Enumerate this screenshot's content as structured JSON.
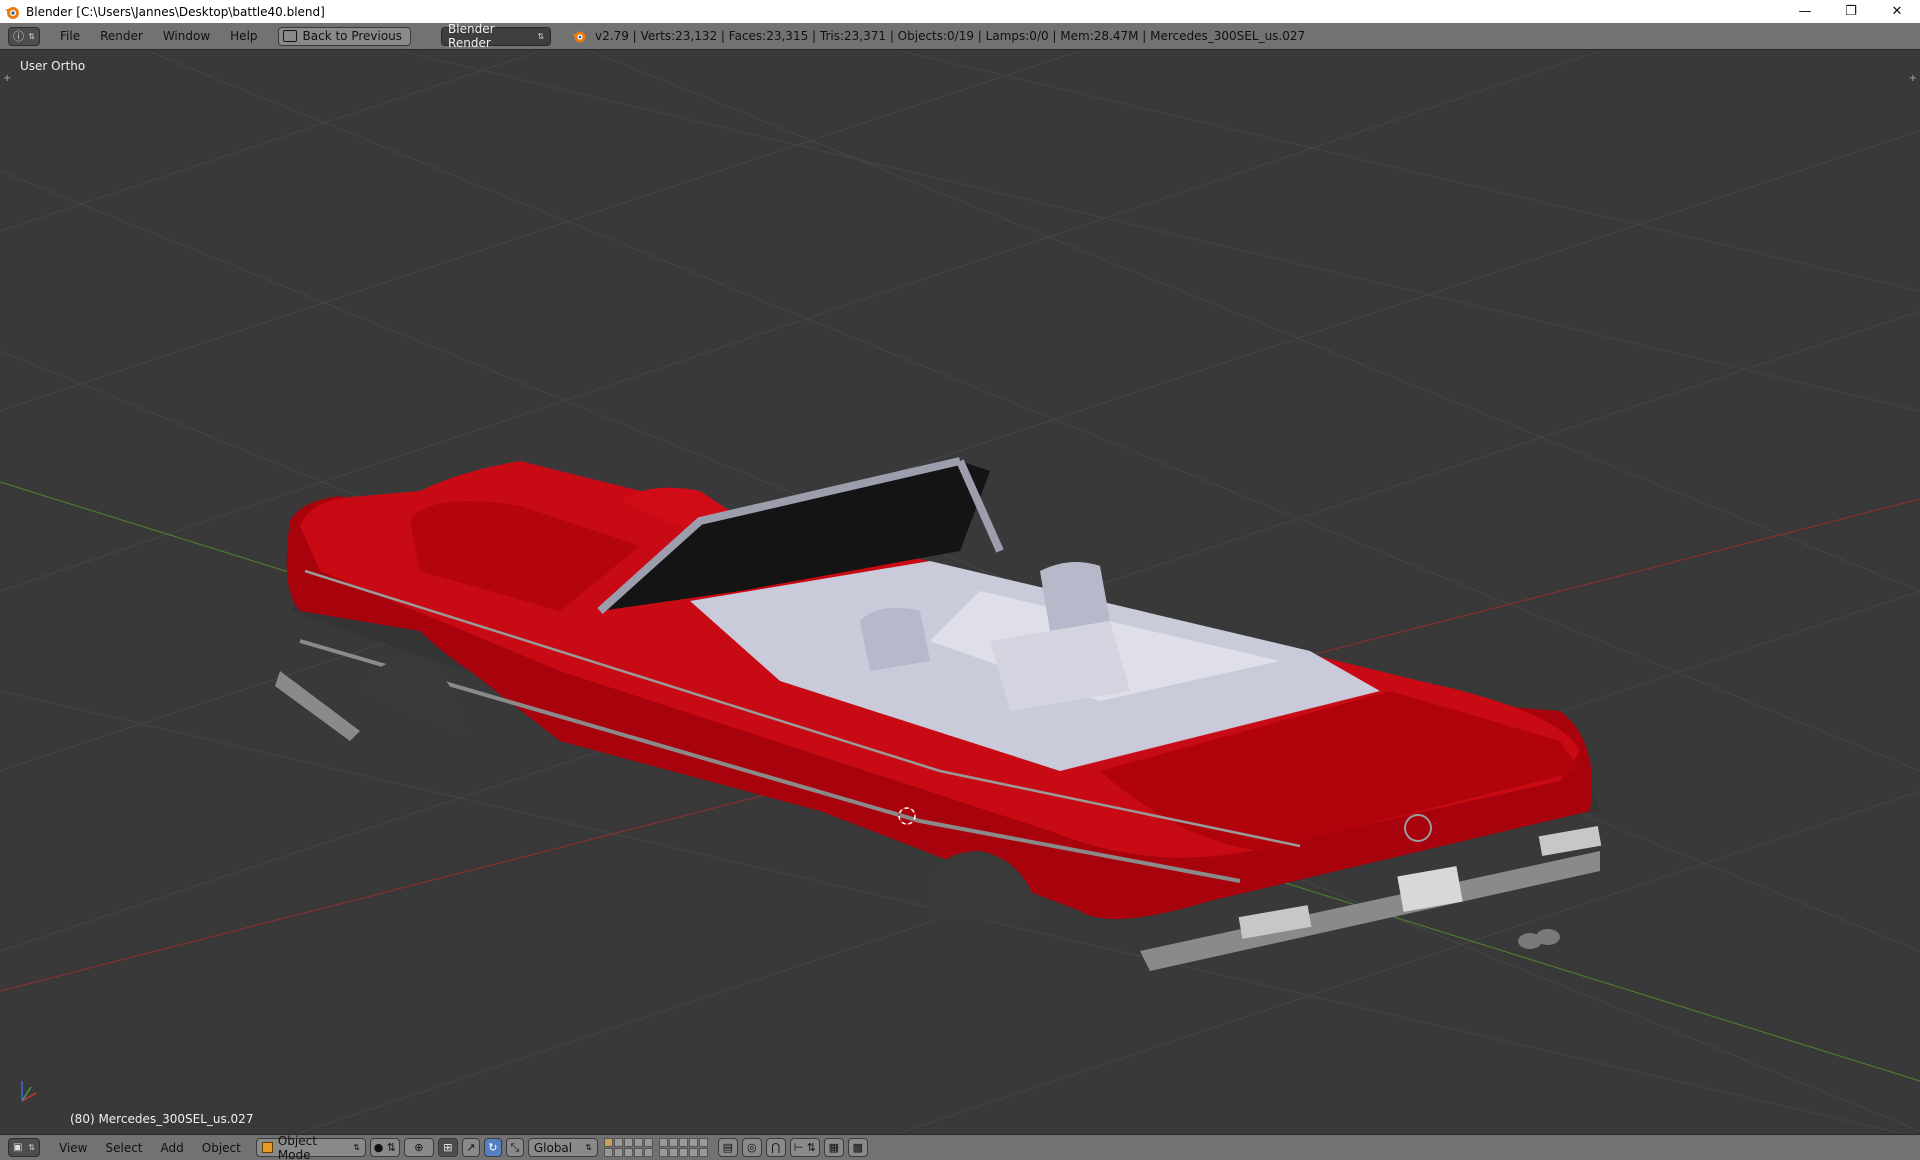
{
  "window": {
    "title": "Blender [C:\\Users\\Jannes\\Desktop\\battle40.blend]",
    "minimize": "—",
    "maximize": "❐",
    "close": "✕"
  },
  "info_header": {
    "menus": [
      "File",
      "Render",
      "Window",
      "Help"
    ],
    "back_label": "Back to Previous",
    "render_engine": "Blender Render",
    "stats": "v2.79 | Verts:23,132 | Faces:23,315 | Tris:23,371 | Objects:0/19 | Lamps:0/0 | Mem:28.47M | Mercedes_300SEL_us.027"
  },
  "viewport": {
    "view_label": "User Ortho",
    "object_label": "(80) Mercedes_300SEL_us.027",
    "model_colors": {
      "body": "#b3040e",
      "interior": "#c4c6d6",
      "trim": "#8a8a8a"
    }
  },
  "bottom_header": {
    "menus": [
      "View",
      "Select",
      "Add",
      "Object"
    ],
    "mode": "Object Mode",
    "orientation": "Global"
  },
  "icons": [
    "blender-logo-icon",
    "info-editor-icon",
    "back-icon",
    "render-icon",
    "viewport-shading-icon",
    "pivot-icon",
    "manipulator-icon",
    "layer-icon",
    "render-preview-icon"
  ]
}
